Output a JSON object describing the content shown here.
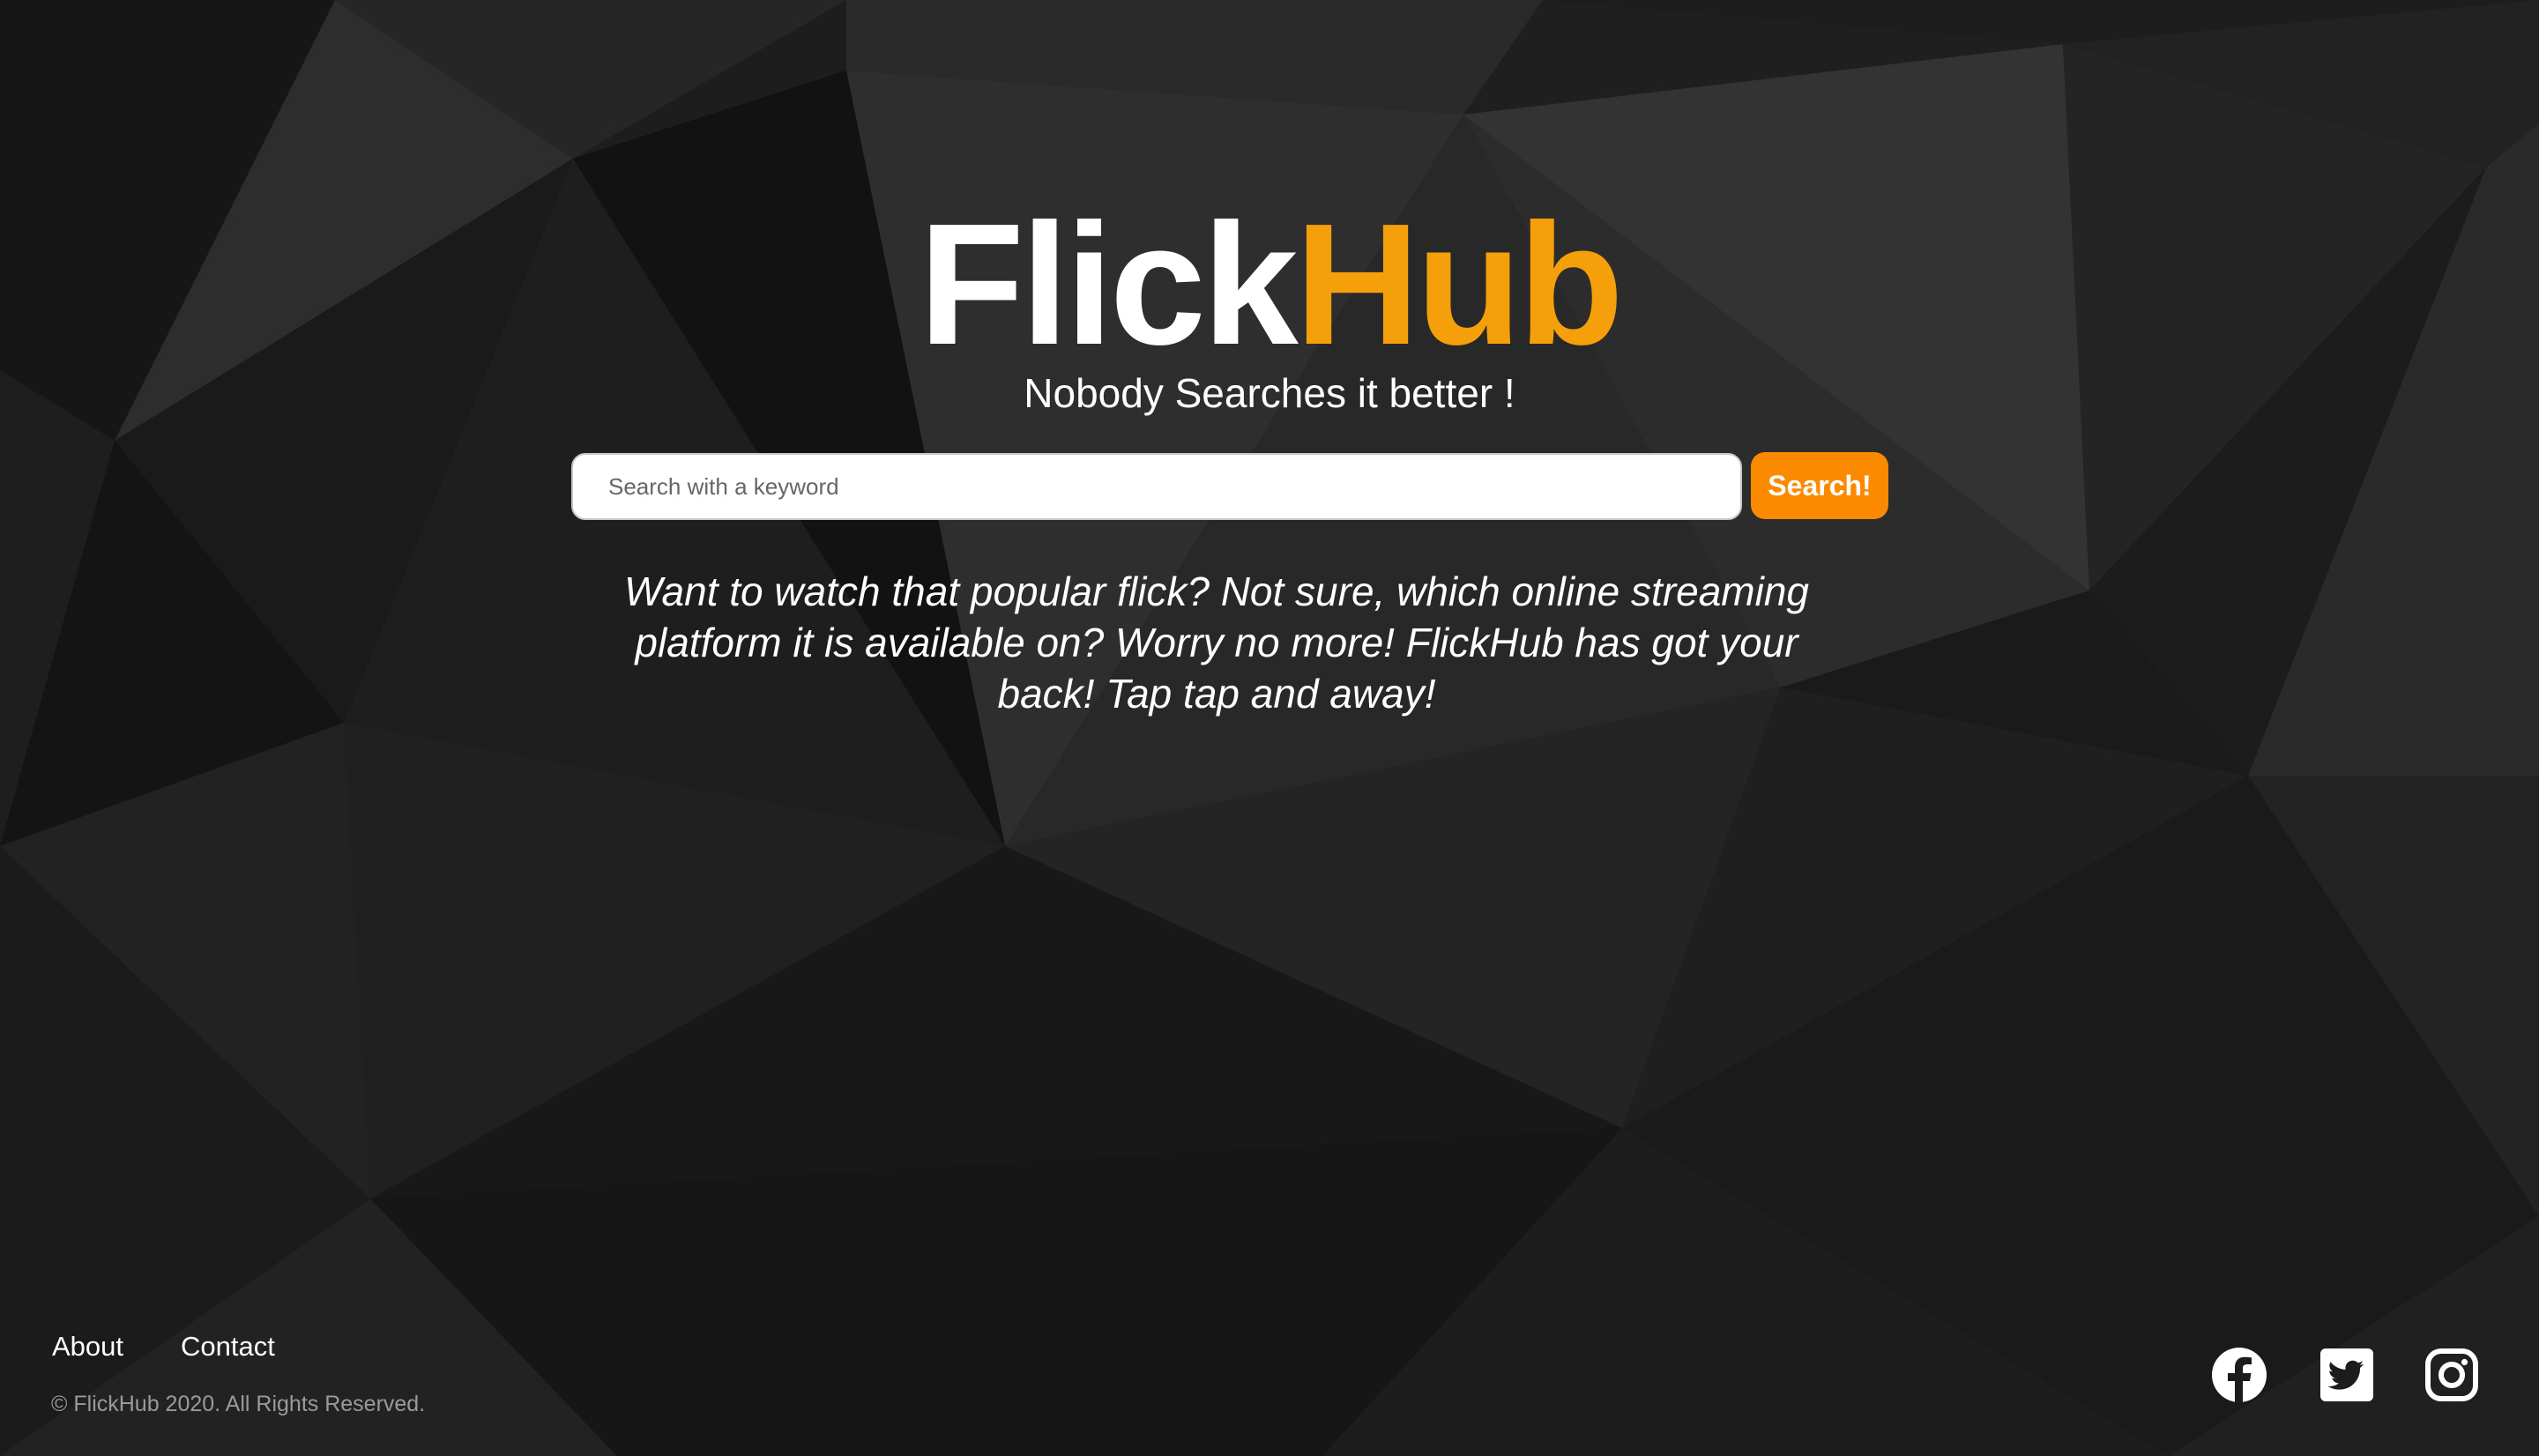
{
  "theme": {
    "accent": "#f5a00b",
    "button_color": "#fb8a00",
    "background": "#1c1c1c",
    "text": "#ffffff"
  },
  "header": {
    "logo_part1": "Flick",
    "logo_part2": "Hub",
    "tagline": "Nobody Searches it better !"
  },
  "search": {
    "placeholder": "Search with a keyword",
    "value": "",
    "button_label": "Search!"
  },
  "main": {
    "description": "Want to watch that popular flick? Not sure, which online streaming platform it is available on? Worry no more! FlickHub has got your back! Tap tap and away!"
  },
  "footer": {
    "links": [
      {
        "label": "About"
      },
      {
        "label": "Contact"
      }
    ],
    "copyright": "© FlickHub 2020. All Rights Reserved.",
    "social": [
      {
        "icon": "facebook-icon"
      },
      {
        "icon": "twitter-icon"
      },
      {
        "icon": "instagram-icon"
      }
    ]
  }
}
